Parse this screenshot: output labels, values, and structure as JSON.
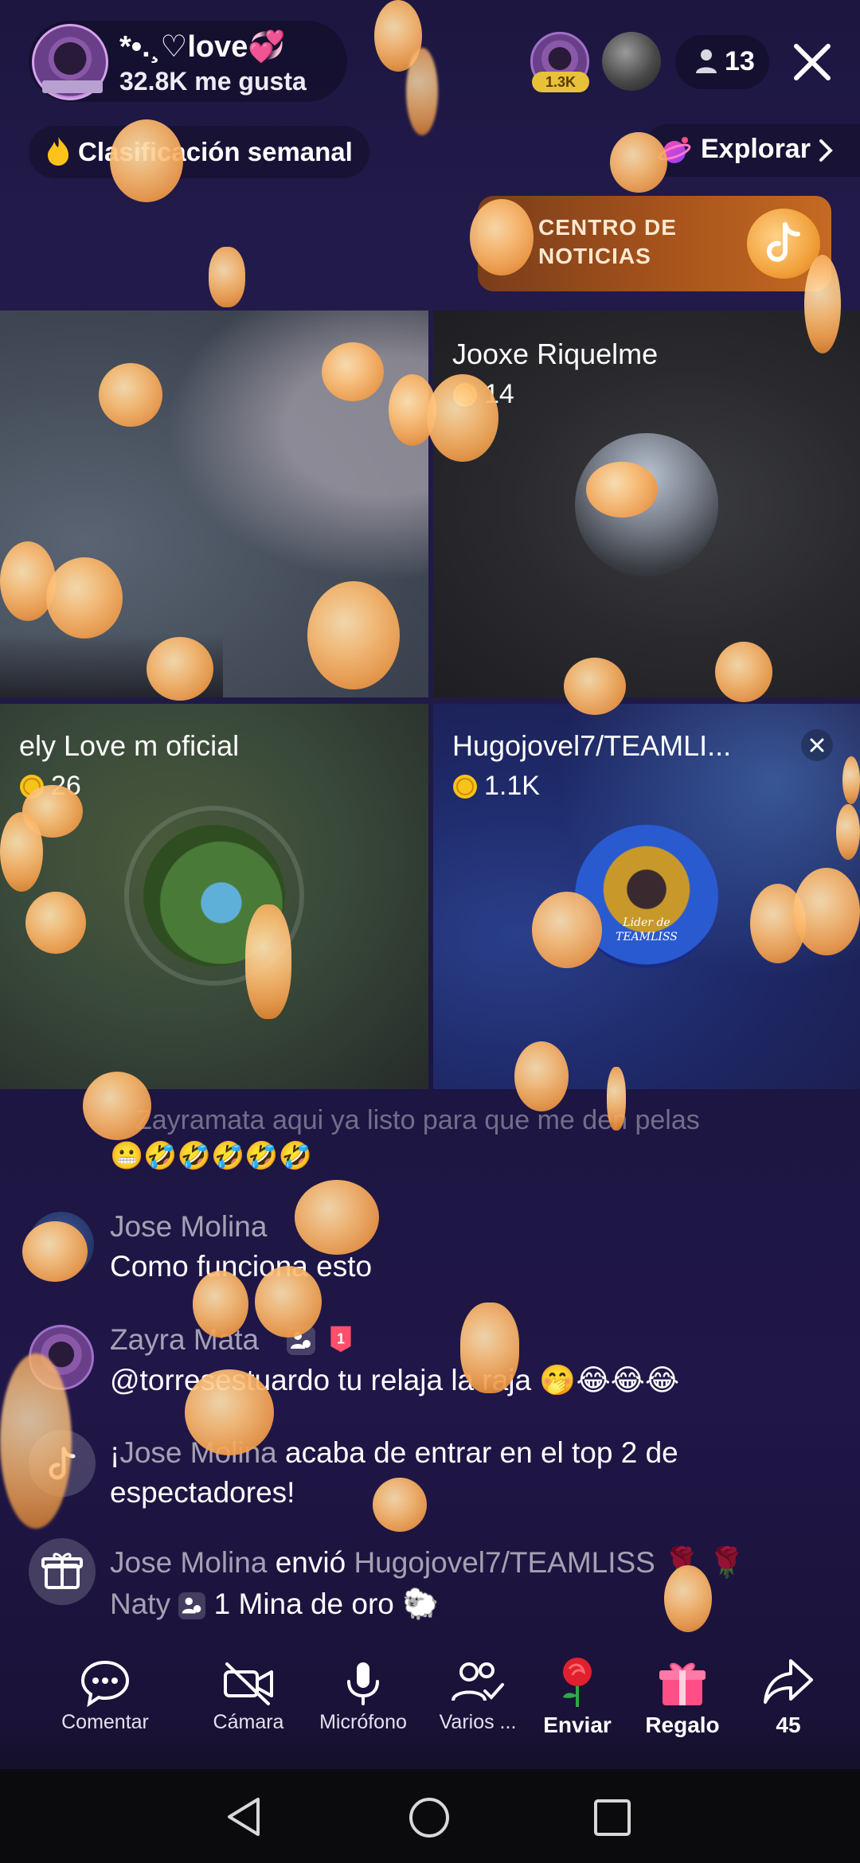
{
  "host": {
    "name": "*•.¸♡love💞",
    "likes": "32.8K me gusta"
  },
  "top_viewers": {
    "first_badge": "1.3K",
    "viewer_count": "13"
  },
  "weekly_ranking": {
    "label": "Clasificación semanal"
  },
  "explore": {
    "label": "Explorar"
  },
  "news_banner": {
    "line1": "CENTRO DE",
    "line2": "NOTICIAS",
    "logo_text": "TikTok LIVE"
  },
  "tiles": [
    {
      "name": "",
      "score": ""
    },
    {
      "name": "Jooxe Riquelme",
      "score": "14"
    },
    {
      "name": "ely Love m oficial",
      "score": "26"
    },
    {
      "name": "Hugojovel7/TEAMLI...",
      "score": "1.1K",
      "avatar_text": "Lider de TEAMLISS"
    }
  ],
  "chat": {
    "faded_line": "Zayramata aqui ya listo para que me den pelas",
    "faded_emojis": "😬🤣🤣🤣🤣🤣",
    "messages": [
      {
        "user": "Jose Molina",
        "text": "Como funciona esto"
      },
      {
        "user": "Zayra Mata",
        "text": "@torresestuardo tu relaja la raja 🤭😂😂😂",
        "rank_badge": "1"
      }
    ],
    "system_top": {
      "prefix": "¡",
      "user": "Jose Molina",
      "text1": " acaba de entrar en el top 2 de",
      "text2": "espectadores!"
    },
    "gift": {
      "user": "Jose Molina",
      "verb": " envió ",
      "recipient": "Hugojovel7/TEAMLISS 🌹 🌹",
      "recipient2": "Naty",
      "gift": "1 Mina de oro 🐑"
    }
  },
  "toolbar": {
    "items": [
      {
        "label": "Comentar",
        "icon": "comment-icon"
      },
      {
        "label": "Cámara",
        "icon": "camera-off-icon"
      },
      {
        "label": "Micrófono",
        "icon": "microphone-icon"
      },
      {
        "label": "Varios ...",
        "icon": "multi-guest-icon"
      },
      {
        "label": "Enviar",
        "icon": "rose-icon"
      },
      {
        "label": "Regalo",
        "icon": "gift-icon"
      },
      {
        "label": "45",
        "icon": "share-icon"
      }
    ]
  },
  "colors": {
    "coin": "#f3a04e",
    "gift_pink": "#ff4f86",
    "rose_red": "#e0202e",
    "badge_gold": "#e8c13a"
  }
}
